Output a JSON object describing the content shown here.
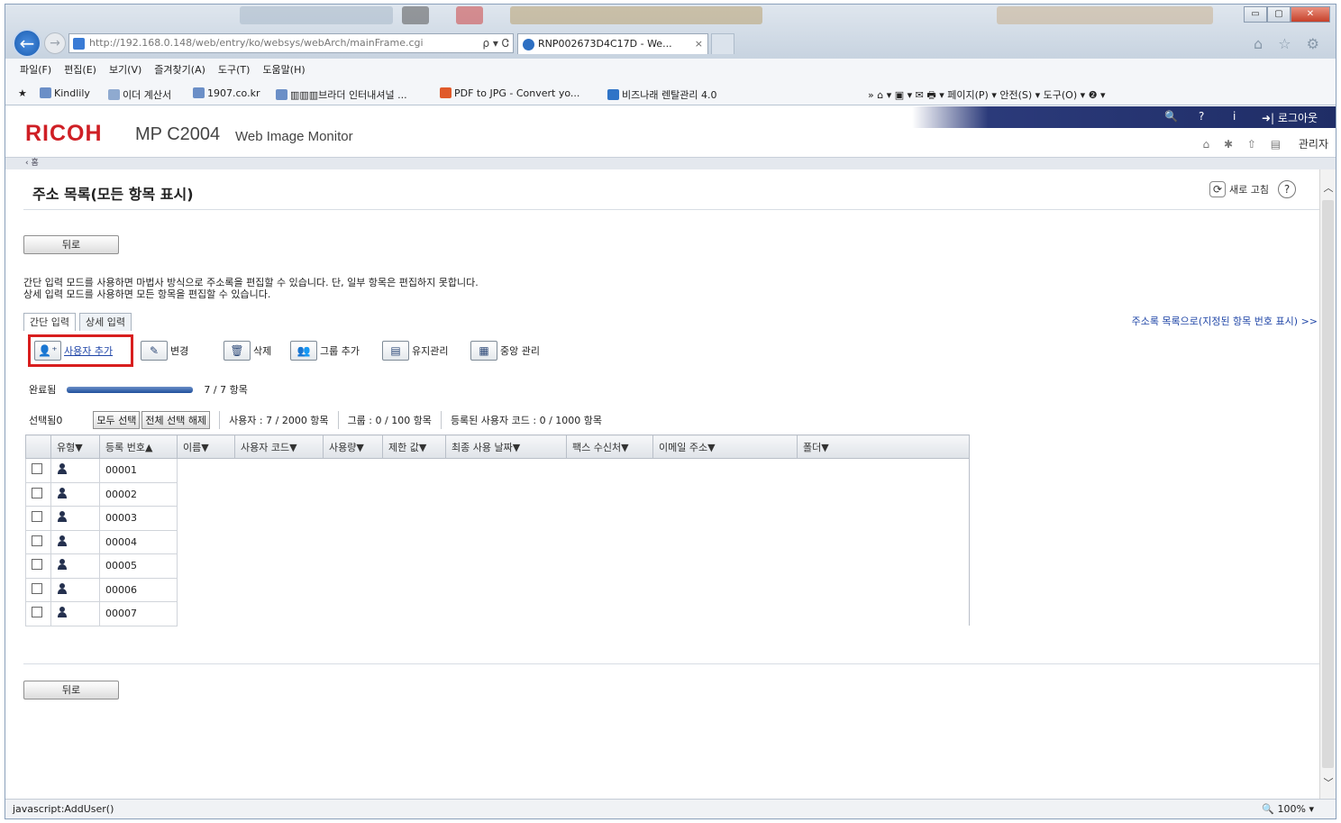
{
  "browser": {
    "address": "http://192.168.0.148/web/entry/ko/websys/webArch/mainFrame.cgi",
    "address_controls": "ρ ▾ Ꮳ",
    "tab_title": "RNP002673D4C17D - We...",
    "tab_close": "×",
    "back_arrow": "←",
    "window_buttons": [
      "▭",
      "▢",
      "✕"
    ],
    "right_icons": "⌂ ☆ ⚙",
    "menu": [
      "파일(F)",
      "편집(E)",
      "보기(V)",
      "즐겨찾기(A)",
      "도구(T)",
      "도움말(H)"
    ],
    "favorites": [
      {
        "label": "Kindlily",
        "color": "#6b8fc7"
      },
      {
        "label": "이더 계산서",
        "color": "#8faad0"
      },
      {
        "label": "1907.co.kr",
        "color": "#6b8fc7"
      },
      {
        "label": "▥▥▥브라더 인터내셔널 ...",
        "color": "#6b8fc7"
      },
      {
        "label": "PDF to JPG - Convert yo...",
        "color": "#e05a2a"
      },
      {
        "label": "비즈나래 렌탈관리 4.0",
        "color": "#2f74c7"
      }
    ],
    "command_bar": "»  ⌂ ▾  ▣ ▾  ✉  🖶 ▾  페이지(P) ▾  안전(S) ▾  도구(O) ▾  ❷ ▾",
    "status_text": "javascript:AddUser()",
    "zoom": "🔍 100%  ▾"
  },
  "header": {
    "logo": "RICOH",
    "model": "MP C2004",
    "product": "Web Image Monitor",
    "top_icons": [
      "🔍",
      "?",
      "i"
    ],
    "logout": "➜| 로그아웃",
    "admin_icons": "⌂ ✱ ⇧ ▤",
    "admin_label": "관리자",
    "crumb": "‹ 홈"
  },
  "page": {
    "title": "주소 목록(모든 항목 표시)",
    "refresh_label": "새로 고침",
    "refresh_icon": "⟳",
    "help_icon": "?",
    "back_button": "뒤로",
    "description_line1": "간단 입력 모드를 사용하면 마법사 방식으로 주소록을 편집할 수 있습니다. 단, 일부 항목은 편집하지 못합니다.",
    "description_line2": "상세 입력 모드를 사용하면 모든 항목을 편집할 수 있습니다.",
    "link_right": "주소록 목록으로(지정된 항목 번호 표시) >>",
    "tabs": [
      "간단 입력",
      "상세 입력"
    ],
    "tools": {
      "add_user": "사용자 추가",
      "change": "변경",
      "delete": "삭제",
      "add_group": "그룹 추가",
      "maintenance": "유지관리",
      "central": "중앙 관리"
    },
    "progress_label": "완료됨",
    "progress_fraction": 1.0,
    "progress_text": "7 / 7 항목",
    "selected_label": "선택됨0",
    "select_all": "모두 선택",
    "deselect_all": "전체 선택 해제",
    "users_count": "사용자 : 7 / 2000 항목",
    "groups_count": "그룹 : 0 / 100 항목",
    "codes_count": "등록된 사용자 코드 : 0 / 1000 항목"
  },
  "table": {
    "columns": [
      "",
      "유형▼",
      "등록 번호▲",
      "이름▼",
      "사용자 코드▼",
      "사용량▼",
      "제한 값▼",
      "최종 사용 날짜▼",
      "팩스 수신처▼",
      "이메일 주소▼",
      "폴더▼"
    ],
    "rows": [
      "00001",
      "00002",
      "00003",
      "00004",
      "00005",
      "00006",
      "00007"
    ]
  },
  "scroll": {
    "up": "︿",
    "down": "﹀"
  }
}
